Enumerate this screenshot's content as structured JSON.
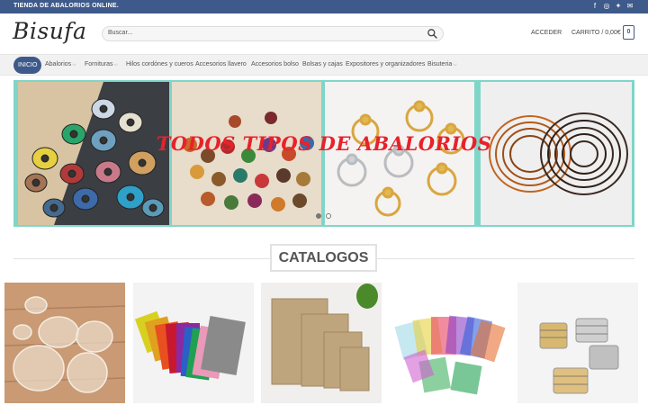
{
  "topbar": {
    "message": "TIENDA DE ABALORIOS ONLINE.",
    "social": [
      {
        "icon": "facebook-icon",
        "glyph": "f"
      },
      {
        "icon": "instagram-icon",
        "glyph": "◎"
      },
      {
        "icon": "twitter-icon",
        "glyph": "✦"
      },
      {
        "icon": "email-icon",
        "glyph": "✉"
      }
    ]
  },
  "header": {
    "logo": "Bisufa",
    "search_placeholder": "Buscar...",
    "login_label": "ACCEDER",
    "cart_label": "CARRITO / 0,00€",
    "cart_count": "0"
  },
  "nav": {
    "items": [
      {
        "label": "INICIO",
        "active": true
      },
      {
        "label": "Abalorios",
        "dropdown": true
      },
      {
        "label": "Fornituras",
        "dropdown": true
      },
      {
        "label": "Hilos cordónes y cueros"
      },
      {
        "label": "Accesorios llavero"
      },
      {
        "label": "Accesorios bolso"
      },
      {
        "label": "Bolsas y cajas"
      },
      {
        "label": "Expositores y organizadores"
      },
      {
        "label": "Bisuteria",
        "dropdown": true
      }
    ]
  },
  "slider": {
    "title": "TODOS TIPOS DE ABALORIOS",
    "active_slide": 1,
    "slide_count": 2
  },
  "catalog": {
    "heading": "CATALOGOS"
  },
  "colors": {
    "brand": "#3e5a8a",
    "slider_border": "#7fd6c8",
    "slider_title": "#e8212a"
  }
}
